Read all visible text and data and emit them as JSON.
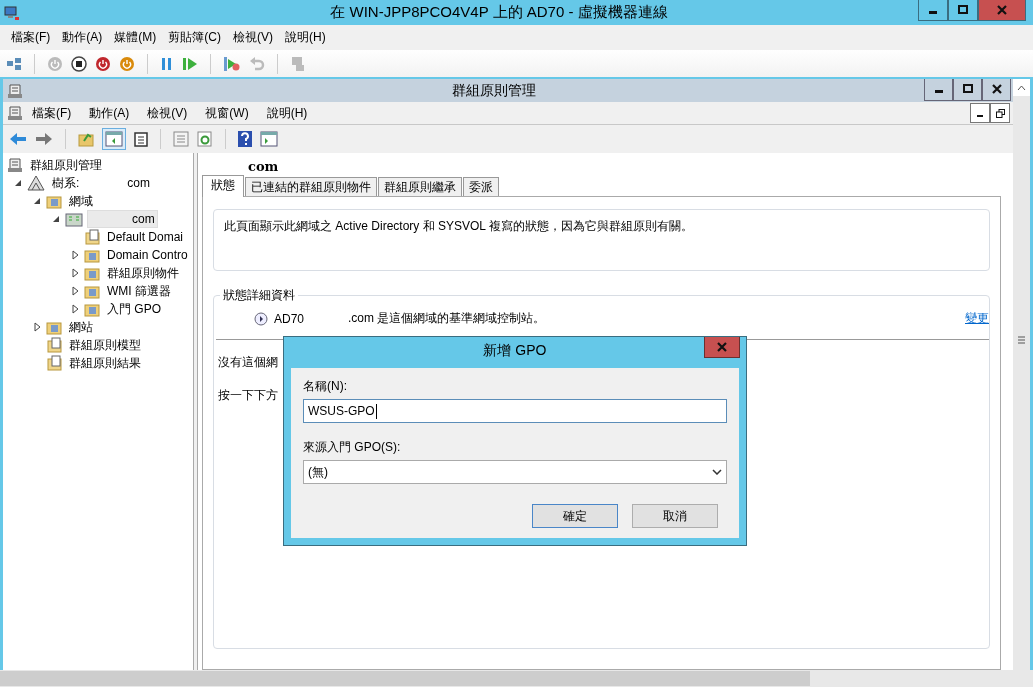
{
  "window": {
    "title": "在 WIN-JPP8PCO4V4P 上的 AD70 - 虛擬機器連線"
  },
  "menu": [
    "檔案(F)",
    "動作(A)",
    "媒體(M)",
    "剪貼簿(C)",
    "檢視(V)",
    "說明(H)"
  ],
  "inner_window": {
    "title": "群組原則管理",
    "menu": [
      "檔案(F)",
      "動作(A)",
      "檢視(V)",
      "視窗(W)",
      "說明(H)"
    ]
  },
  "tree": {
    "items": [
      {
        "label": "群組原則管理",
        "kind": "root",
        "selected": false,
        "children": [
          {
            "label": "樹系:",
            "suffix": "com",
            "kind": "branch",
            "expanded": true,
            "selected": false,
            "children": [
              {
                "label": "網域",
                "kind": "branch",
                "expanded": true,
                "selected": false,
                "children": [
                  {
                    "label": "com",
                    "kind": "branch",
                    "expanded": true,
                    "selected": true,
                    "children": [
                      {
                        "label": "Default Domai",
                        "kind": "leaf",
                        "selected": false
                      },
                      {
                        "label": "Domain Contro",
                        "kind": "branch",
                        "expanded": false,
                        "selected": false
                      },
                      {
                        "label": "群組原則物件",
                        "kind": "branch",
                        "expanded": false,
                        "selected": false
                      },
                      {
                        "label": "WMI 篩選器",
                        "kind": "branch",
                        "expanded": false,
                        "selected": false
                      },
                      {
                        "label": "入門 GPO",
                        "kind": "branch",
                        "expanded": false,
                        "selected": false
                      }
                    ]
                  }
                ]
              },
              {
                "label": "網站",
                "kind": "branch",
                "expanded": false,
                "selected": false
              },
              {
                "label": "群組原則模型",
                "kind": "leaf",
                "selected": false
              },
              {
                "label": "群組原則結果",
                "kind": "leaf",
                "selected": false
              }
            ]
          }
        ]
      }
    ]
  },
  "content": {
    "header": "com",
    "tabs": [
      {
        "label": "狀態",
        "selected": true
      },
      {
        "label": "已連結的群組原則物件",
        "selected": false
      },
      {
        "label": "群組原則繼承",
        "selected": false
      },
      {
        "label": "委派",
        "selected": false
      }
    ],
    "description": "此頁面顯示此網域之 Active Directory 和 SYSVOL 複寫的狀態，因為它與群組原則有關。",
    "details": {
      "title": "狀態詳細資料",
      "server": "AD70",
      "message": ".com 是這個網域的基準網域控制站。",
      "link": "變更"
    },
    "notes": [
      "沒有這個網",
      "按一下下方"
    ]
  },
  "dialog": {
    "title": "新增 GPO",
    "name_label": "名稱(N):",
    "name_value": "WSUS-GPO",
    "source_label": "來源入門 GPO(S):",
    "source_value": "(無)",
    "buttons": [
      {
        "label": "確定",
        "kind": "default"
      },
      {
        "label": "取消",
        "kind": "normal"
      }
    ]
  }
}
